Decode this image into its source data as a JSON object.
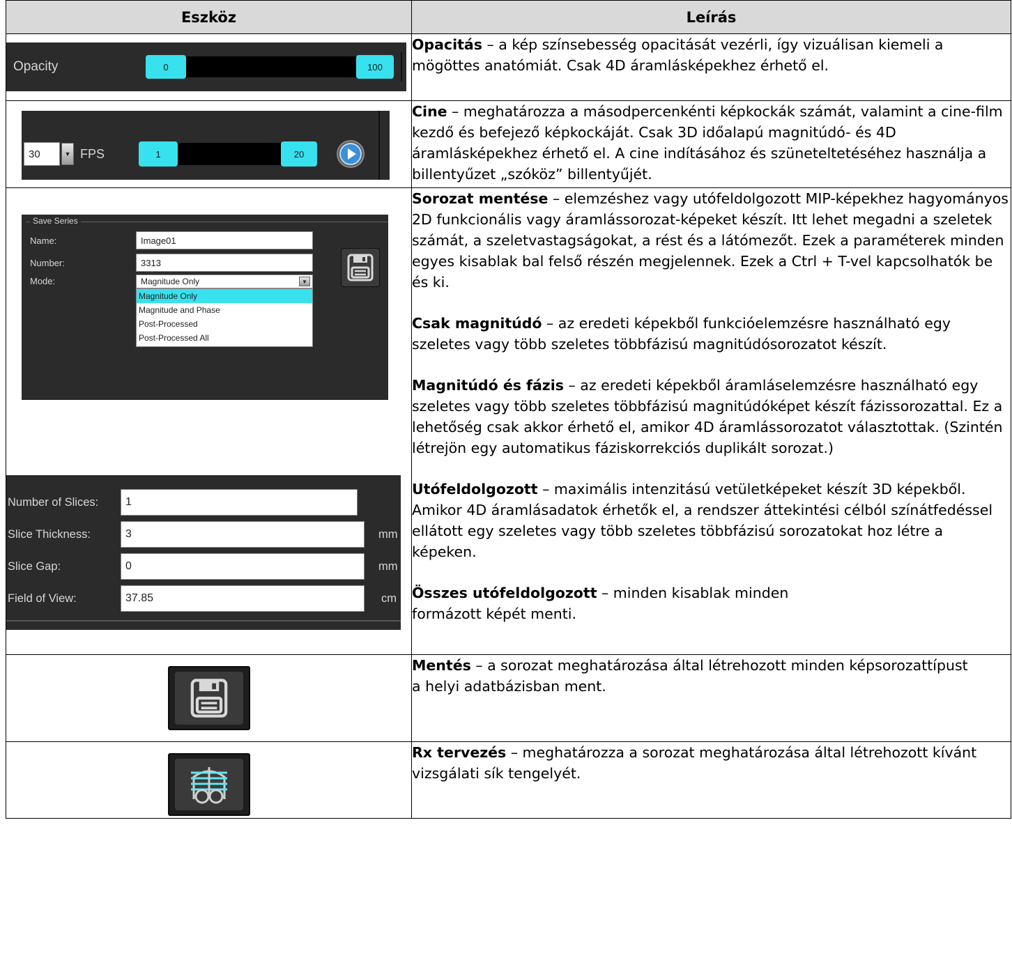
{
  "header": {
    "col_tool": "Eszköz",
    "col_desc": "Leírás"
  },
  "rows": {
    "opacity": {
      "widget": {
        "label": "Opacity",
        "min": "0",
        "max": "100"
      },
      "title": "Opacitás",
      "text": " – a kép színsebesség opacitását vezérli, így vizuálisan kiemeli a mögöttes anatómiát. Csak 4D áramlásképekhez érhető el."
    },
    "cine": {
      "widget": {
        "fps_value": "30",
        "fps_label": "FPS",
        "start": "1",
        "end": "20"
      },
      "title": "Cine",
      "text": " – meghatározza a másodpercenkénti képkockák számát, valamint a cine-film kezdő és befejező képkockáját. Csak 3D időalapú magnitúdó- és 4D áramlásképekhez érhető el. A cine indításához és szüneteltetéséhez használja a billentyűzet „szóköz” billentyűjét."
    },
    "save_series": {
      "panel": {
        "legend": "Save Series",
        "name_label": "Name:",
        "name_value": "Image01",
        "number_label": "Number:",
        "number_value": "3313",
        "mode_label": "Mode:",
        "mode_value": "Magnitude Only",
        "options": [
          "Magnitude Only",
          "Magnitude and Phase",
          "Post-Processed",
          "Post-Processed All"
        ]
      },
      "slices": {
        "count_label": "Number of Slices:",
        "count_value": "1",
        "thickness_label": "Slice Thickness:",
        "thickness_value": "3",
        "thickness_unit": "mm",
        "gap_label": "Slice Gap:",
        "gap_value": "0",
        "gap_unit": "mm",
        "fov_label": "Field of View:",
        "fov_value": "37.85",
        "fov_unit": "cm"
      },
      "paragraphs": [
        {
          "title": "Sorozat mentése",
          "text": " – elemzéshez vagy utófeldolgozott MIP-képekhez hagyományos 2D funkcionális vagy áramlássorozat-képeket készít. Itt lehet megadni a szeletek számát, a szeletvastagságokat, a rést és a látómezőt. Ezek a paraméterek minden egyes kisablak bal felső részén megjelennek. Ezek a Ctrl + T-vel kapcsolhatók be és ki."
        },
        {
          "title": "Csak magnitúdó",
          "text": " – az eredeti képekből funkcióelemzésre használható egy szeletes vagy több szeletes többfázisú magnitúdósorozatot készít."
        },
        {
          "title": "Magnitúdó és fázis",
          "text": " – az eredeti képekből áramláselemzésre használható egy szeletes vagy több szeletes többfázisú magnitúdóképet készít fázissorozattal. Ez a lehetőség csak akkor érhető el, amikor 4D áramlássorozatot választottak. (Szintén létrejön egy automatikus fáziskorrekciós duplikált sorozat.)"
        },
        {
          "title": "Utófeldolgozott",
          "text": " – maximális intenzitású vetületképeket készít 3D képekből. Amikor 4D áramlásadatok érhetők el, a rendszer áttekintési célból színátfedéssel ellátott egy szeletes vagy több szeletes többfázisú sorozatokat hoz létre a képeken."
        },
        {
          "title": "Összes utófeldolgozott",
          "text": " – minden kisablak minden formázott képét menti."
        }
      ]
    },
    "save": {
      "title": "Mentés",
      "text": " – a sorozat meghatározása által létrehozott minden képsorozattípust a helyi adatbázisban ment.",
      "icon": "floppy-disk-icon"
    },
    "rx": {
      "title": "Rx tervezés",
      "text": " – meghatározza a sorozat meghatározása által létrehozott kívánt vizsgálati sík tengelyét.",
      "icon": "rx-planning-icon"
    }
  },
  "colors": {
    "accent": "#38e1ee",
    "panel_dark": "#2b2b2b",
    "header_bg": "#d9d9d9"
  }
}
